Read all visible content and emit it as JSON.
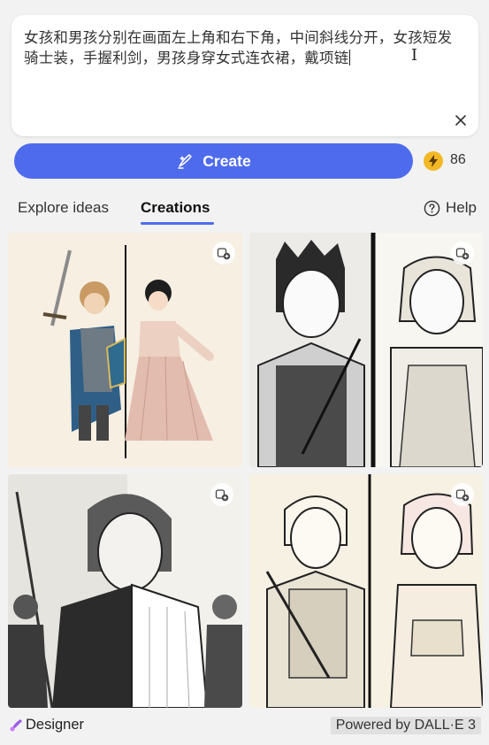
{
  "prompt": {
    "text": "女孩和男孩分别在画面左上角和右下角，中间斜线分开，女孩短发骑士装，手握利剑，男孩身穿女式连衣裙，戴项链"
  },
  "create_button": {
    "label": "Create"
  },
  "boosts": {
    "count": "86"
  },
  "tabs": {
    "explore": "Explore ideas",
    "creations": "Creations",
    "active": "creations"
  },
  "help": {
    "label": "Help"
  },
  "results": [
    {
      "style": "color"
    },
    {
      "style": "bw"
    },
    {
      "style": "bw"
    },
    {
      "style": "bw"
    }
  ],
  "footer": {
    "brand": "Designer",
    "powered_by": "Powered by DALL·E 3"
  },
  "colors": {
    "accent": "#4f6bed",
    "boost": "#f2b826"
  }
}
